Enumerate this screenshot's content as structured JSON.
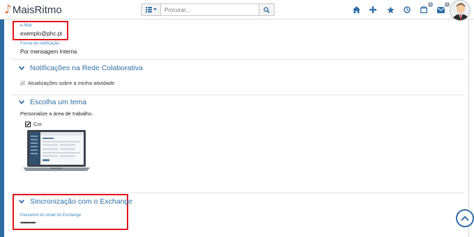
{
  "app": {
    "logo_text": "MaisRitmo"
  },
  "search": {
    "placeholder": "Procurar..."
  },
  "nav": {
    "notifications_badge": "1",
    "messages_badge": "1"
  },
  "profile": {
    "email_label": "e-Mail",
    "email_value": "exemplo@phc.pt",
    "notification_form_label": "Forma de notificação",
    "notification_form_value": "Por mensagem Interna"
  },
  "sections": {
    "collab": {
      "title": "Notificações na Rede Colaborativa",
      "checkbox_label": "Atualizações sobre a minha atividade"
    },
    "theme": {
      "title": "Escolha um tema",
      "description": "Personalize a área de trabalho.",
      "option_label": "Cor"
    },
    "exchange": {
      "title": "Sincronização com o Exchange",
      "password_label": "Password do email do Exchange",
      "password_value": "••••••••••••"
    }
  },
  "colors": {
    "accent": "#2f6fa6",
    "highlight": "#e3121b",
    "logo_note": "#e06b28"
  }
}
